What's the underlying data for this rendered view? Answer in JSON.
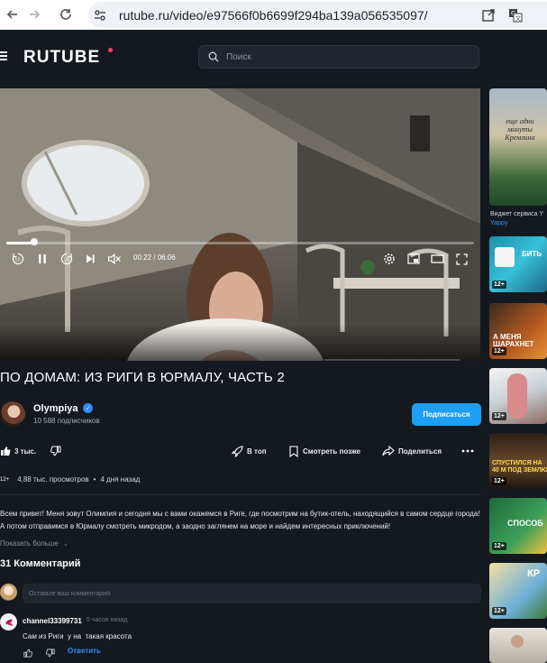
{
  "browser": {
    "url": "rutube.ru/video/e97566f0b6699f294ba139a056535097/"
  },
  "header": {
    "logo": "RUTUBE",
    "search_placeholder": "Поиск"
  },
  "player": {
    "time_current": "00:22",
    "time_total": "06:06",
    "time_display": "00:22 / 06:06",
    "progress_fraction": 0.06,
    "skip_back_label": "10",
    "skip_fwd_label": "10"
  },
  "video": {
    "title": "ПО ДОМАМ: ИЗ РИГИ В ЮРМАЛУ, ЧАСТЬ 2",
    "channel_name": "Olympiya",
    "subscribers": "10 588 подписчиков",
    "subscribe_label": "Подписаться",
    "likes": "3 тыс.",
    "actions": {
      "top": "В топ",
      "watch_later": "Смотреть позже",
      "share": "Поделиться"
    },
    "age_rating": "12+",
    "views": "4,88 тыс. просмотров",
    "posted": "4 дня назад",
    "description": "Всем привет! Меня зовут Олимпия и сегодня мы с вами окажемся в Риге, где посмотрим на бутик-отель, находящийся в самом сердце города! А потом отправимся в Юрмалу смотреть микродом, а заодно заглянем на море и найдем интересных приключений!",
    "show_more": "Показать больше"
  },
  "comments": {
    "header": "31 Комментарий",
    "input_placeholder": "Оставьте ваш комментарий",
    "items": [
      {
        "author": "channel33399731",
        "time": "5 часов назад",
        "text": "Сам из Риги  у на  такая красота",
        "reply_label": "Ответить"
      }
    ]
  },
  "sidebar": {
    "items": [
      {
        "caption": "еще одни минуты Кремлина",
        "title": "Виджет сервиса Y",
        "subtitle": "Yappy",
        "badge": ""
      },
      {
        "caption": "БИТЬ",
        "title": "",
        "subtitle": "",
        "badge": "12+"
      },
      {
        "caption": "А МЕНЯ ШАРАХНЕТ",
        "title": "",
        "subtitle": "",
        "badge": "12+"
      },
      {
        "caption": "",
        "title": "",
        "subtitle": "",
        "badge": "12+"
      },
      {
        "caption": "СПУСТИЛСЯ НА 40 М ПОД ЗЕМЛЮ",
        "title": "",
        "subtitle": "",
        "badge": "12+"
      },
      {
        "caption": "СПОСОБ",
        "title": "",
        "subtitle": "",
        "badge": "12+"
      },
      {
        "caption": "КР",
        "title": "",
        "subtitle": "",
        "badge": "12+"
      },
      {
        "caption": "",
        "title": "",
        "subtitle": "",
        "badge": ""
      }
    ]
  },
  "colors": {
    "background": "#14191f",
    "accent": "#1e9ef5",
    "link": "#2e8bff"
  }
}
